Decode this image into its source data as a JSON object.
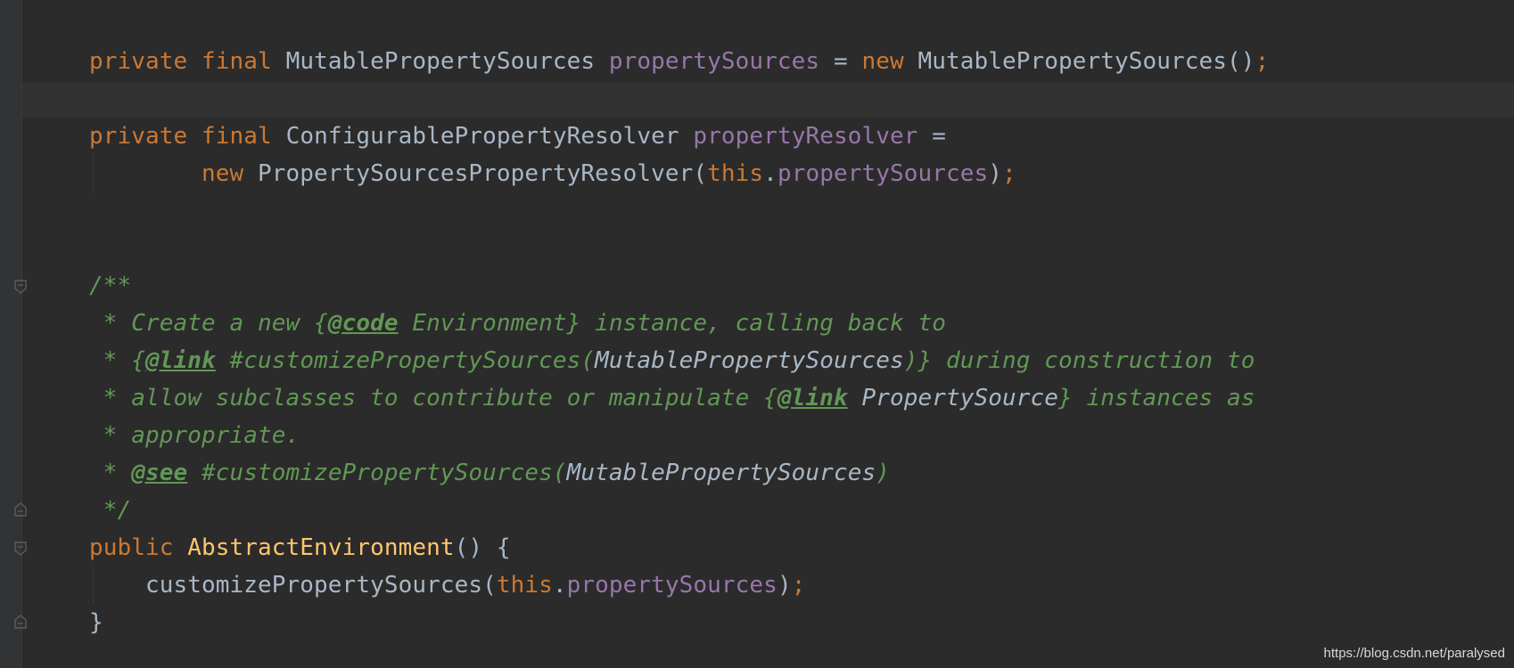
{
  "editor": {
    "lines": [
      [
        {
          "t": "private ",
          "c": "kw"
        },
        {
          "t": "final ",
          "c": "kw"
        },
        {
          "t": "MutablePropertySources ",
          "c": "plain"
        },
        {
          "t": "propertySources",
          "c": "fld"
        },
        {
          "t": " = ",
          "c": "plain"
        },
        {
          "t": "new ",
          "c": "kw"
        },
        {
          "t": "MutablePropertySources()",
          "c": "plain"
        },
        {
          "t": ";",
          "c": "kw"
        }
      ],
      [
        {
          "t": "private ",
          "c": "kw"
        },
        {
          "t": "final ",
          "c": "kw"
        },
        {
          "t": "ConfigurablePropertyResolver ",
          "c": "plain"
        },
        {
          "t": "propertyResolver",
          "c": "fld"
        },
        {
          "t": " =",
          "c": "plain"
        }
      ],
      [
        {
          "t": "        ",
          "c": "plain"
        },
        {
          "t": "new ",
          "c": "kw"
        },
        {
          "t": "PropertySourcesPropertyResolver(",
          "c": "plain"
        },
        {
          "t": "this",
          "c": "kw"
        },
        {
          "t": ".",
          "c": "plain"
        },
        {
          "t": "propertySources",
          "c": "fld"
        },
        {
          "t": ")",
          "c": "plain"
        },
        {
          "t": ";",
          "c": "kw"
        }
      ],
      [
        {
          "t": "/**",
          "c": "doc"
        }
      ],
      [
        {
          "t": " * Create a new {",
          "c": "doc"
        },
        {
          "t": "@code",
          "c": "tag"
        },
        {
          "t": " Environment} instance, calling back to",
          "c": "doc"
        }
      ],
      [
        {
          "t": " * {",
          "c": "doc"
        },
        {
          "t": "@link",
          "c": "tag"
        },
        {
          "t": " #customizePropertySources(",
          "c": "doc"
        },
        {
          "t": "MutablePropertySources",
          "c": "docref"
        },
        {
          "t": ")} during construction to",
          "c": "doc"
        }
      ],
      [
        {
          "t": " * allow subclasses to contribute or manipulate {",
          "c": "doc"
        },
        {
          "t": "@link",
          "c": "tag"
        },
        {
          "t": " ",
          "c": "doc"
        },
        {
          "t": "PropertySource",
          "c": "docref"
        },
        {
          "t": "} instances as",
          "c": "doc"
        }
      ],
      [
        {
          "t": " * appropriate.",
          "c": "doc"
        }
      ],
      [
        {
          "t": " * ",
          "c": "doc"
        },
        {
          "t": "@see",
          "c": "tag"
        },
        {
          "t": " #customizePropertySources(",
          "c": "doc"
        },
        {
          "t": "MutablePropertySources",
          "c": "docref"
        },
        {
          "t": ")",
          "c": "doc"
        }
      ],
      [
        {
          "t": " */",
          "c": "doc"
        }
      ],
      [
        {
          "t": "public ",
          "c": "kw"
        },
        {
          "t": "AbstractEnvironment",
          "c": "fn"
        },
        {
          "t": "() {",
          "c": "plain"
        }
      ],
      [
        {
          "t": "    customizePropertySources(",
          "c": "plain"
        },
        {
          "t": "this",
          "c": "kw"
        },
        {
          "t": ".",
          "c": "plain"
        },
        {
          "t": "propertySources",
          "c": "fld"
        },
        {
          "t": ")",
          "c": "plain"
        },
        {
          "t": ";",
          "c": "kw"
        }
      ],
      [
        {
          "t": "}",
          "c": "plain"
        }
      ]
    ]
  },
  "watermark": "https://blog.csdn.net/paralysed",
  "colors": {
    "background": "#2b2b2b",
    "keyword": "#cc7832",
    "field": "#9876aa",
    "method": "#ffc66d",
    "doc_comment": "#629755",
    "text": "#a9b7c6"
  }
}
